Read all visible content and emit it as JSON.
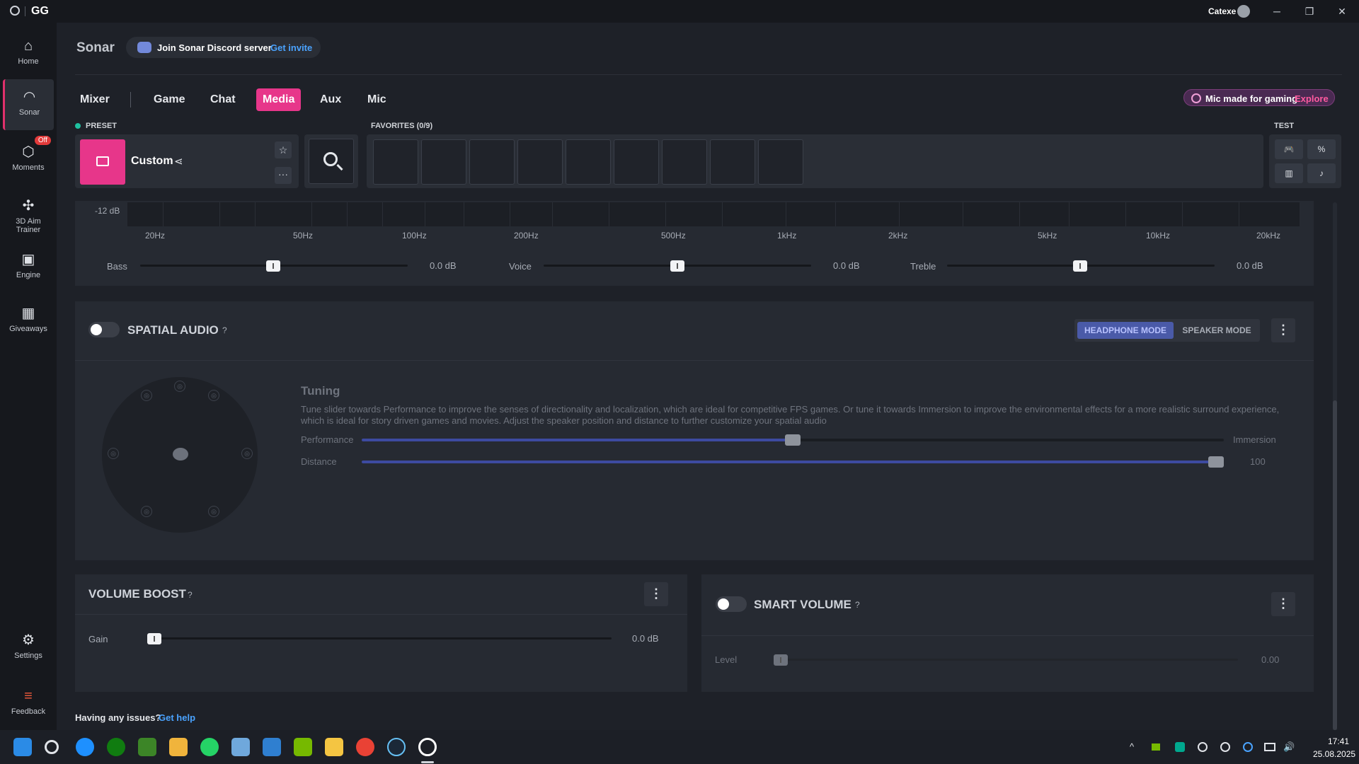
{
  "titlebar": {
    "app": "GG",
    "user": "Catexe",
    "minimize": "─",
    "restore": "❐",
    "close": "✕"
  },
  "sidebar": {
    "items": [
      {
        "label": "Home",
        "icon": "⌂"
      },
      {
        "label": "Sonar",
        "icon": "◠"
      },
      {
        "label": "Moments",
        "icon": "⬡",
        "badge": "Off"
      },
      {
        "label": "3D Aim",
        "label2": "Trainer",
        "icon": "✣"
      },
      {
        "label": "Engine",
        "icon": "▣"
      },
      {
        "label": "Giveaways",
        "icon": "▦"
      },
      {
        "label": "Settings",
        "icon": "⚙"
      },
      {
        "label": "Feedback",
        "icon": "≡"
      }
    ]
  },
  "header": {
    "title": "Sonar",
    "discord_text": "Join Sonar Discord server",
    "discord_link": "Get invite"
  },
  "tabs": [
    "Mixer",
    "Game",
    "Chat",
    "Media",
    "Aux",
    "Mic"
  ],
  "active_tab": "Media",
  "promo": {
    "text": "Mic made for gaming",
    "link": "Explore"
  },
  "preset": {
    "label": "PRESET",
    "name": "Custom",
    "share_icon": "⋖",
    "star_icon": "☆",
    "more_icon": "···"
  },
  "favorites": {
    "label": "FAVORITES (0/9)"
  },
  "test": {
    "label": "TEST",
    "buttons": [
      "🎮",
      "%",
      "▥",
      "♪"
    ]
  },
  "eq": {
    "db_label": "-12 dB",
    "freqs": [
      "20Hz",
      "50Hz",
      "100Hz",
      "200Hz",
      "500Hz",
      "1kHz",
      "2kHz",
      "5kHz",
      "10kHz",
      "20kHz"
    ],
    "sliders": [
      {
        "label": "Bass",
        "value": "0.0 dB",
        "level": 0.5
      },
      {
        "label": "Voice",
        "value": "0.0 dB",
        "level": 0.5
      },
      {
        "label": "Treble",
        "value": "0.0 dB",
        "level": 0.5
      }
    ]
  },
  "spatial": {
    "title": "SPATIAL AUDIO",
    "help": "?",
    "enabled": false,
    "mode_headphone": "HEADPHONE MODE",
    "mode_speaker": "SPEAKER MODE",
    "menu_icon": "⋮",
    "tuning_title": "Tuning",
    "tuning_desc": "Tune slider towards Performance to improve the senses of directionality and localization, which are ideal for competitive FPS games. Or tune it towards Immersion to improve the environmental effects for a more realistic surround experience, which is ideal for story driven games and movies. Adjust the speaker position and distance to further customize your spatial audio",
    "performance_label": "Performance",
    "immersion_label": "Immersion",
    "tuning_level": 0.5,
    "distance_label": "Distance",
    "distance_value": "100",
    "distance_level": 1.0
  },
  "volume_boost": {
    "title": "VOLUME BOOST",
    "help": "?",
    "gain_label": "Gain",
    "gain_value": "0.0 dB",
    "gain_level": 0.0,
    "menu_icon": "⋮"
  },
  "smart_volume": {
    "title": "SMART VOLUME",
    "help": "?",
    "level_label": "Level",
    "level_value": "0.00",
    "level_level": 0.0,
    "enabled": false,
    "menu_icon": "⋮"
  },
  "help": {
    "text": "Having any issues?",
    "link": "Get help"
  },
  "taskbar": {
    "apps": [
      "windows-start",
      "search",
      "edge",
      "xbox",
      "minecraft",
      "store",
      "whatsapp",
      "control-panel",
      "photos",
      "nvidia",
      "file-explorer",
      "chrome",
      "steam",
      "steelseries-gg"
    ],
    "tray": [
      "^",
      "nvidia",
      "kaspersky",
      "back",
      "steelseries",
      "cortana",
      "network",
      "volume"
    ],
    "time": "17:41",
    "date": "25.08.2025"
  },
  "colors": {
    "accent": "#e7368a",
    "link": "#4aa3ff",
    "slider_fill": "#3d4aa0",
    "headphone_mode": "#4a5aa8"
  }
}
